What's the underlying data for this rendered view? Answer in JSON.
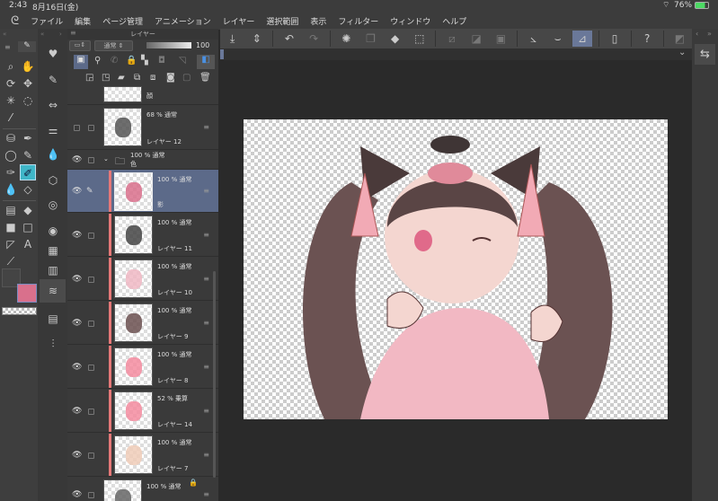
{
  "status": {
    "time": "2:43",
    "date": "8月16日(金)",
    "battery": "76%"
  },
  "menu": [
    "ファイル",
    "編集",
    "ページ管理",
    "アニメーション",
    "レイヤー",
    "選択範囲",
    "表示",
    "フィルター",
    "ウィンドウ",
    "ヘルプ"
  ],
  "layer_panel": {
    "title": "レイヤー",
    "blend_mode": "通常",
    "opacity": "100"
  },
  "layers": [
    {
      "name": "顔",
      "mode": "",
      "partial": true,
      "eye": false,
      "clip": false
    },
    {
      "name": "レイヤー 12",
      "mode": "68 % 通常",
      "eye": false,
      "clip": false,
      "thumb": "#555"
    },
    {
      "name": "色",
      "mode": "100 % 通常",
      "folder": true,
      "eye": true
    },
    {
      "name": "影",
      "mode": "100 % 通常",
      "eye": true,
      "clip": true,
      "selected": true,
      "thumb": "#d9708c"
    },
    {
      "name": "レイヤー 11",
      "mode": "100 % 通常",
      "eye": true,
      "clip": true,
      "thumb": "#444"
    },
    {
      "name": "レイヤー 10",
      "mode": "100 % 通常",
      "eye": true,
      "clip": true,
      "thumb": "#f0b8c4"
    },
    {
      "name": "レイヤー 9",
      "mode": "100 % 通常",
      "eye": true,
      "clip": true,
      "thumb": "#6b5050"
    },
    {
      "name": "レイヤー 8",
      "mode": "100 % 通常",
      "eye": true,
      "clip": true,
      "thumb": "#f58ca0"
    },
    {
      "name": "レイヤー 14",
      "mode": "52 % 乗算",
      "eye": true,
      "clip": true,
      "thumb": "#f58ca0"
    },
    {
      "name": "レイヤー 7",
      "mode": "100 % 通常",
      "eye": true,
      "clip": true,
      "thumb": "#f0cdb8"
    },
    {
      "name": "",
      "mode": "100 % 通常",
      "eye": true,
      "clip": false,
      "locked": true,
      "thumb": "#666"
    }
  ],
  "colors": {
    "main": "#444444",
    "sub": "#d9708c",
    "accent": "#6a7899"
  }
}
